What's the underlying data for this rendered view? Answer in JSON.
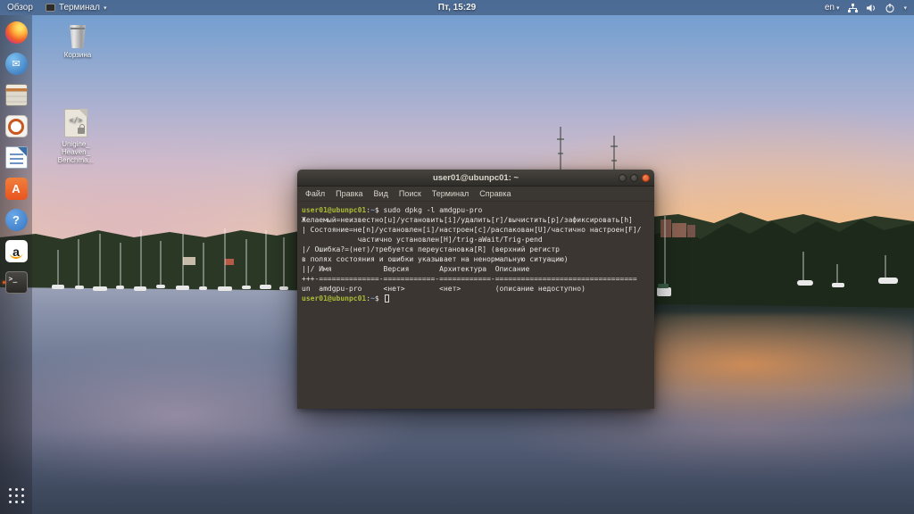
{
  "top_bar": {
    "activities": "Обзор",
    "app_menu": "Терминал",
    "app_menu_caret": "▾",
    "clock": "Пт, 15:29",
    "keyboard_layout": "en",
    "status_icons": [
      "network-icon",
      "volume-icon",
      "power-icon"
    ],
    "status_caret": "▾"
  },
  "dock": {
    "items": [
      {
        "id": "firefox"
      },
      {
        "id": "thunderbird",
        "glyph": "✉"
      },
      {
        "id": "files"
      },
      {
        "id": "rhythmbox"
      },
      {
        "id": "writer"
      },
      {
        "id": "software",
        "glyph": "A"
      },
      {
        "id": "help",
        "glyph": "?"
      },
      {
        "id": "amazon",
        "glyph": "a"
      },
      {
        "id": "terminal",
        "glyph": ">_",
        "running": true
      }
    ]
  },
  "desktop": {
    "icons": [
      {
        "id": "trash",
        "label": "Корзина"
      },
      {
        "id": "unigine-heaven-file",
        "glyph": "</>",
        "label_lines": [
          "Unigine_",
          "Heaven_",
          "Benchma..."
        ]
      }
    ]
  },
  "window": {
    "title": "user01@ubunpc01: ~",
    "buttons": [
      "minimize",
      "maximize",
      "close"
    ],
    "menu": [
      {
        "id": "file",
        "label": "Файл"
      },
      {
        "id": "edit",
        "label": "Правка"
      },
      {
        "id": "view",
        "label": "Вид"
      },
      {
        "id": "search",
        "label": "Поиск"
      },
      {
        "id": "terminal",
        "label": "Терминал"
      },
      {
        "id": "help",
        "label": "Справка"
      }
    ],
    "terminal_lines": [
      {
        "segments": [
          {
            "text": "user01@ubunpc01",
            "color": "prompt"
          },
          {
            "text": ":",
            "color": "fg"
          },
          {
            "text": "~",
            "color": "dir"
          },
          {
            "text": "$ sudo dpkg -l amdgpu-pro",
            "color": "fg"
          }
        ]
      },
      {
        "segments": [
          {
            "text": "Желаемый=неизвестно[u]/установить[i]/удалить[r]/вычистить[p]/зафиксировать[h]",
            "color": "fg"
          }
        ]
      },
      {
        "segments": [
          {
            "text": "| Состояние=не[n]/установлен[i]/настроен[c]/распакован[U]/частично настроен[F]/",
            "color": "fg"
          }
        ]
      },
      {
        "segments": [
          {
            "text": "             частично установлен[H]/trig-aWait/Trig-pend",
            "color": "fg"
          }
        ]
      },
      {
        "segments": [
          {
            "text": "|/ Ошибка?=(нет)/требуется переустановка[R] (верхний регистр",
            "color": "fg"
          }
        ]
      },
      {
        "segments": [
          {
            "text": "в полях состояния и ошибки указывает на ненормальную ситуацию)",
            "color": "fg"
          }
        ]
      },
      {
        "segments": [
          {
            "text": "||/ Имя            Версия       Архитектура  Описание",
            "color": "fg"
          }
        ]
      },
      {
        "segments": [
          {
            "text": "+++-==============-============-============-=================================",
            "color": "fg"
          }
        ]
      },
      {
        "segments": [
          {
            "text": "un  amdgpu-pro     <нет>        <нет>        (описание недоступно)",
            "color": "fg"
          }
        ]
      },
      {
        "segments": [
          {
            "text": "user01@ubunpc01",
            "color": "prompt"
          },
          {
            "text": ":",
            "color": "fg"
          },
          {
            "text": "~",
            "color": "dir"
          },
          {
            "text": "$ ",
            "color": "fg"
          }
        ],
        "cursor": true
      }
    ]
  },
  "colors": {
    "prompt_green": "#a9ba38",
    "path_blue": "#7e9fd0",
    "terminal_bg": "#3b3632",
    "close_button": "#dd4814",
    "ubuntu_orange": "#e95420"
  }
}
